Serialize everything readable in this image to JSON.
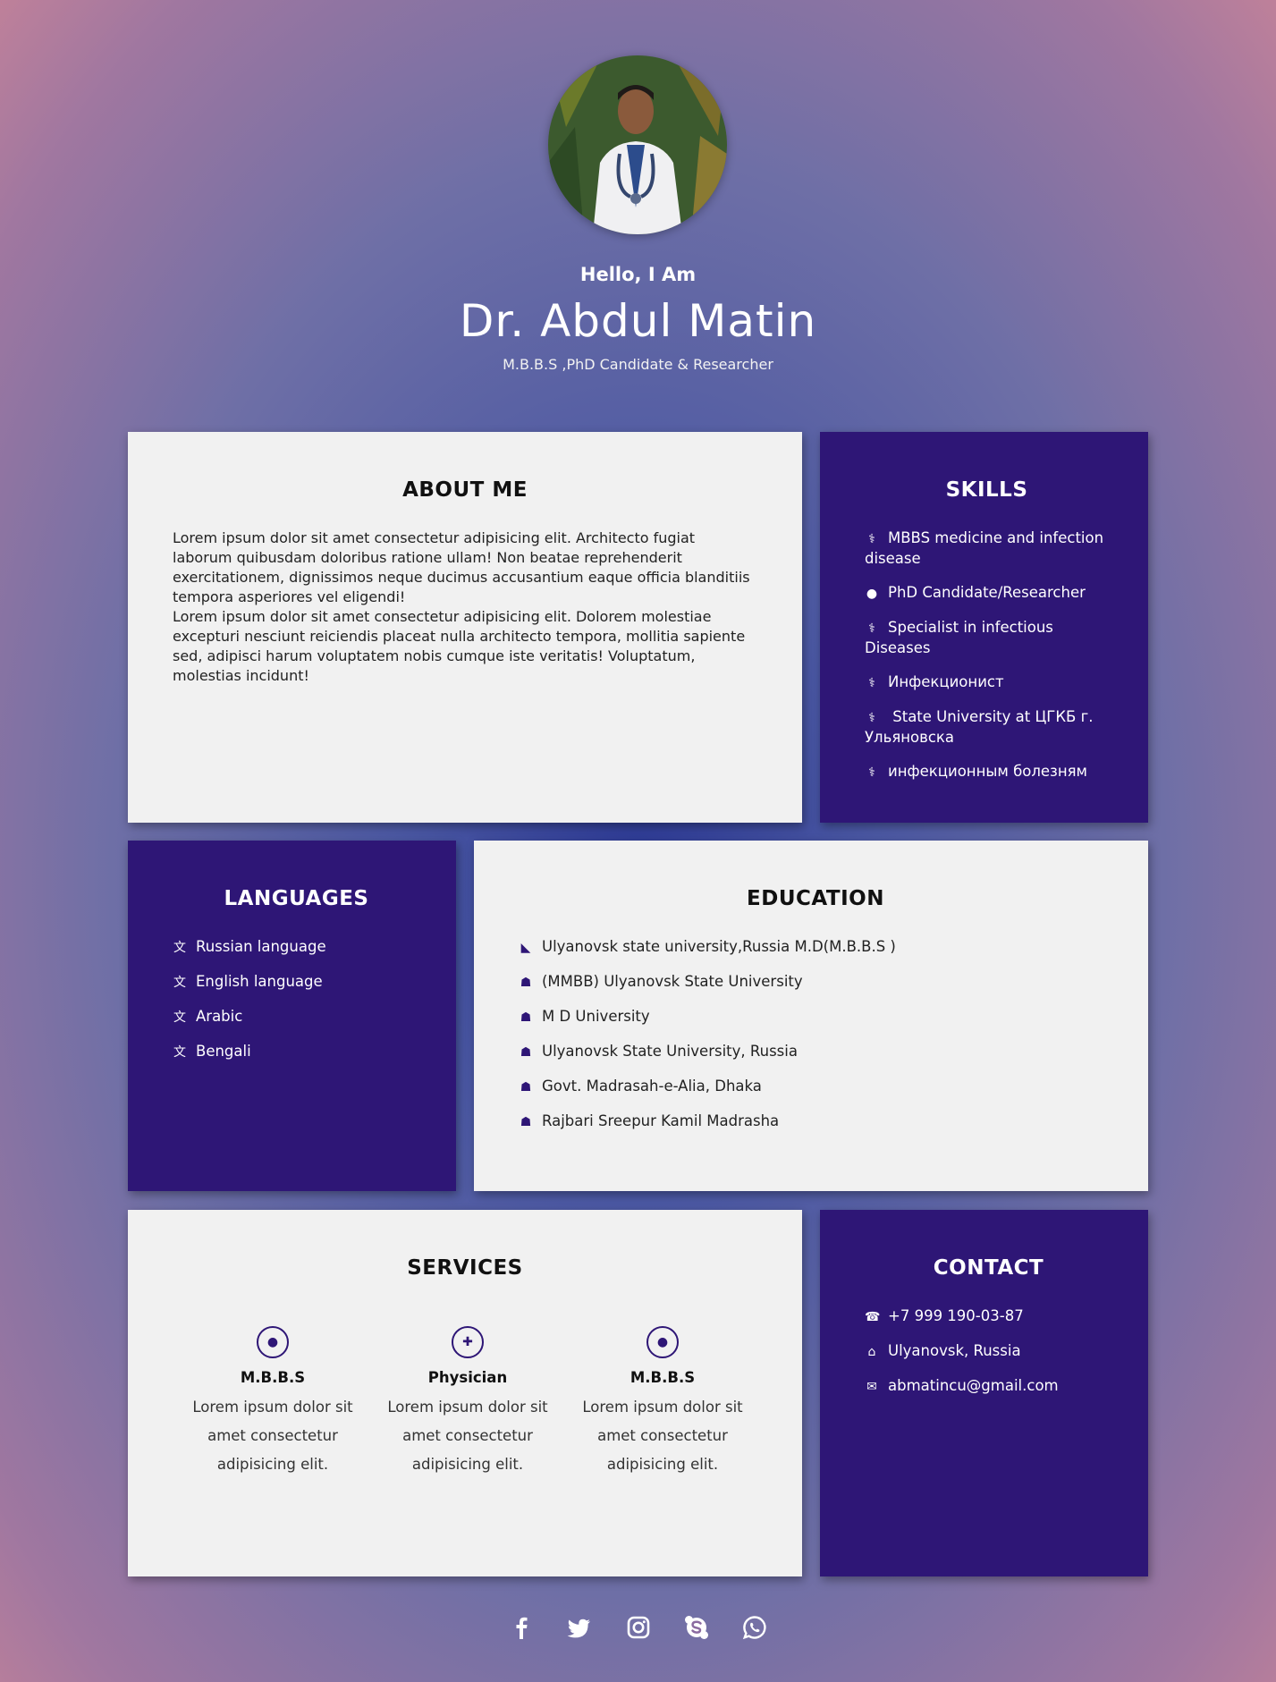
{
  "hero": {
    "hello": "Hello, I Am",
    "name": "Dr. Abdul Matin",
    "tagline": "M.B.B.S ,PhD Candidate & Researcher"
  },
  "about": {
    "title": "ABOUT ME",
    "paragraph1": "Lorem ipsum dolor sit amet consectetur adipisicing elit. Architecto fugiat laborum quibusdam doloribus ratione ullam! Non beatae reprehenderit exercitationem, dignissimos neque ducimus accusantium eaque officia blanditiis tempora asperiores vel eligendi!",
    "paragraph2": "Lorem ipsum dolor sit amet consectetur adipisicing elit. Dolorem molestiae excepturi nesciunt reiciendis placeat nulla architecto tempora, mollitia sapiente sed, adipisci harum voluptatem nobis cumque iste veritatis! Voluptatum, molestias incidunt!"
  },
  "skills": {
    "title": "SKILLS",
    "items": [
      {
        "icon": "stethoscope-icon",
        "label": "MBBS medicine and infection disease"
      },
      {
        "icon": "user-icon",
        "label": "PhD Candidate/Researcher"
      },
      {
        "icon": "stethoscope-icon",
        "label": "Specialist in infectious Diseases"
      },
      {
        "icon": "stethoscope-icon",
        "label": "Инфекционист"
      },
      {
        "icon": "stethoscope-icon",
        "label": " State University at ЦГКБ г. Ульяновска"
      },
      {
        "icon": "stethoscope-icon",
        "label": "инфекционным болезням"
      }
    ]
  },
  "languages": {
    "title": "LANGUAGES",
    "items": [
      {
        "icon": "language-icon",
        "label": "Russian language"
      },
      {
        "icon": "language-icon",
        "label": "English language"
      },
      {
        "icon": "language-icon",
        "label": "Arabic"
      },
      {
        "icon": "language-icon",
        "label": "Bengali"
      }
    ]
  },
  "education": {
    "title": "EDUCATION",
    "items": [
      {
        "icon": "graduation-cap-icon",
        "label": "Ulyanovsk state university,Russia M.D(M.B.B.S )"
      },
      {
        "icon": "institution-icon",
        "label": "(MMBB) Ulyanovsk State University"
      },
      {
        "icon": "institution-icon",
        "label": "M D University"
      },
      {
        "icon": "institution-icon",
        "label": "Ulyanovsk State University, Russia"
      },
      {
        "icon": "institution-icon",
        "label": "Govt. Madrasah-e-Alia, Dhaka"
      },
      {
        "icon": "institution-icon",
        "label": "Rajbari Sreepur Kamil Madrasha"
      }
    ]
  },
  "services": {
    "title": "SERVICES",
    "items": [
      {
        "icon": "user-icon",
        "title": "M.B.B.S",
        "desc": "Lorem ipsum dolor sit amet consectetur adipisicing elit."
      },
      {
        "icon": "medkit-icon",
        "title": "Physician",
        "desc": "Lorem ipsum dolor sit amet consectetur adipisicing elit."
      },
      {
        "icon": "user-icon",
        "title": "M.B.B.S",
        "desc": "Lorem ipsum dolor sit amet consectetur adipisicing elit."
      }
    ]
  },
  "contact": {
    "title": "CONTACT",
    "items": [
      {
        "icon": "phone-icon",
        "label": "+7 999 190-03-87"
      },
      {
        "icon": "home-icon",
        "label": "Ulyanovsk, Russia"
      },
      {
        "icon": "envelope-icon",
        "label": "abmatincu@gmail.com"
      }
    ]
  },
  "social": [
    "facebook-icon",
    "twitter-icon",
    "instagram-icon",
    "skype-icon",
    "whatsapp-icon"
  ],
  "colors": {
    "card_dark": "#2e1676",
    "card_light": "#f1f1f1",
    "accent": "#2e1676"
  }
}
